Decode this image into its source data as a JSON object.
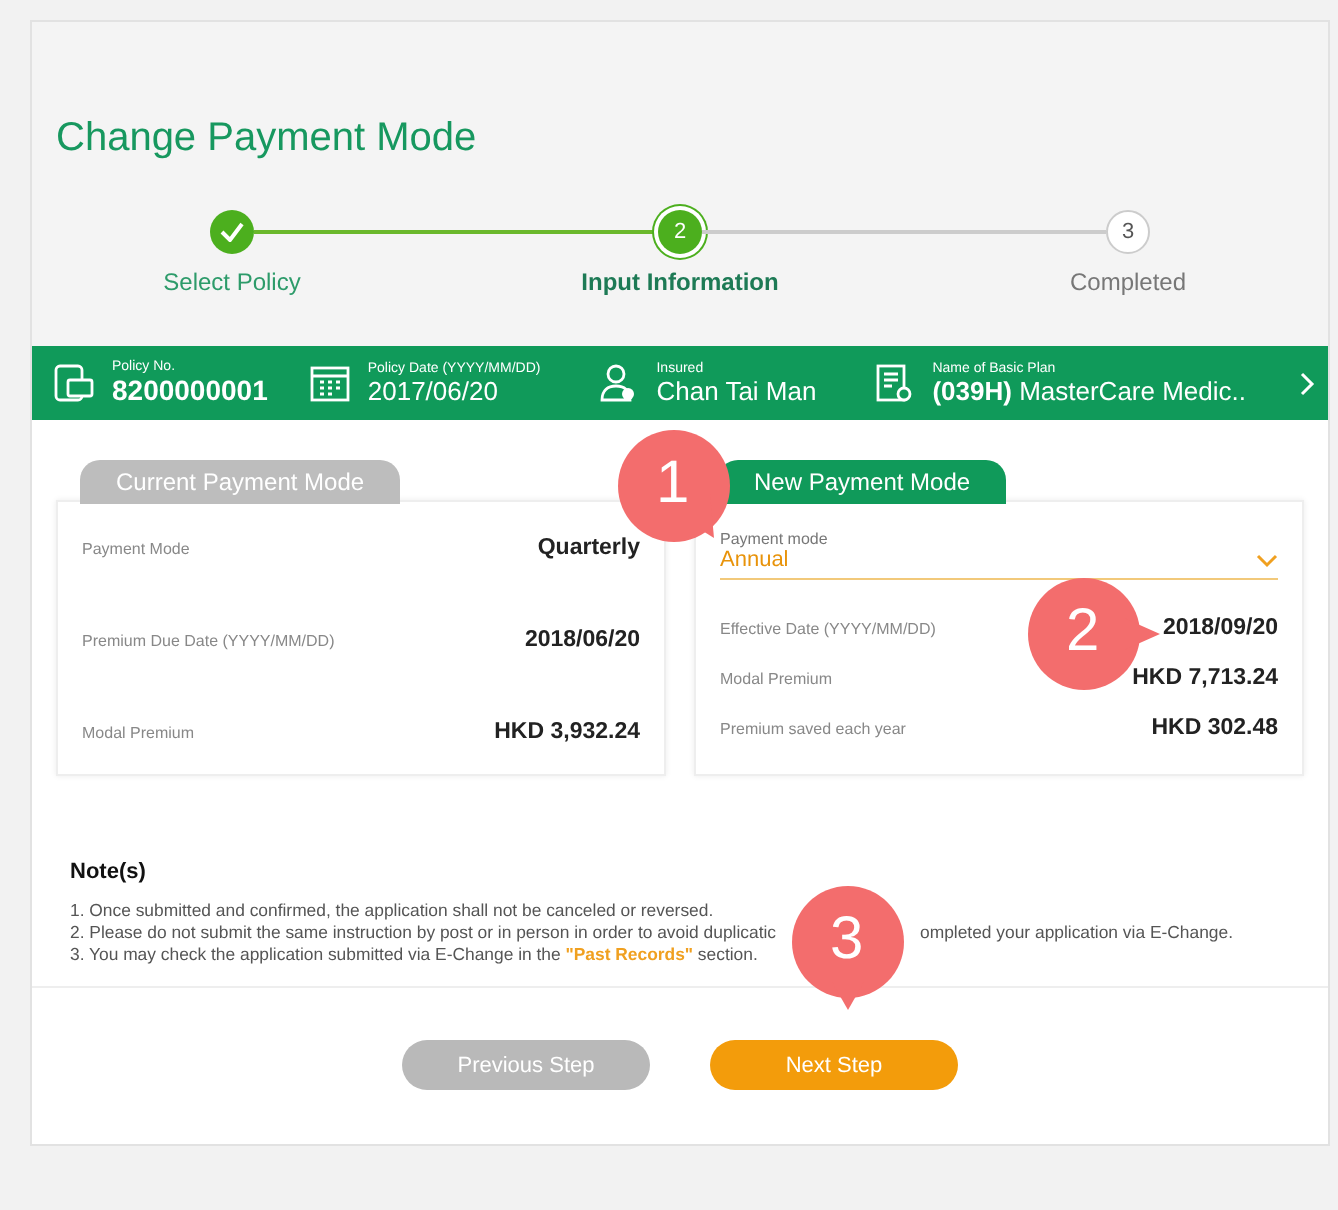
{
  "title": "Change Payment Mode",
  "steps": [
    {
      "label": "Select Policy",
      "done": true,
      "selected": false
    },
    {
      "label": "Input Information",
      "number": "2",
      "done": false,
      "selected": true
    },
    {
      "label": "Completed",
      "number": "3",
      "done": false,
      "selected": false
    }
  ],
  "policy_bar": [
    {
      "kind": "policy",
      "label": "Policy No.",
      "value": "8200000001"
    },
    {
      "kind": "calendar",
      "label": "Policy Date (YYYY/MM/DD)",
      "value": "2017/06/20"
    },
    {
      "kind": "person",
      "label": "Insured",
      "value": "Chan Tai Man"
    },
    {
      "kind": "plan",
      "label": "Name of Basic Plan",
      "value": "**(039H)** MasterCare Medic.."
    }
  ],
  "current_mode": {
    "heading": "Current Payment Mode",
    "rows": [
      {
        "label": "Payment Mode",
        "value": "Quarterly"
      },
      {
        "label": "Premium Due Date (YYYY/MM/DD)",
        "value": "2018/06/20"
      },
      {
        "label": "Modal Premium",
        "value": "HKD 3,932.24"
      }
    ]
  },
  "new_mode": {
    "heading": "New Payment Mode",
    "select": {
      "label": "Payment mode",
      "value": "Annual"
    },
    "rows": [
      {
        "label": "Effective Date (YYYY/MM/DD)",
        "value": "2018/09/20"
      },
      {
        "label": "Modal Premium",
        "value": "HKD 7,713.24"
      },
      {
        "label": "Premium saved each year",
        "value": "HKD 302.48"
      }
    ]
  },
  "notes": {
    "heading": "Note(s)",
    "lines": [
      [
        "1. Once submitted and confirmed, the application shall not be canceled or reversed."
      ],
      [
        "2. Please do not submit the same instruction by post or in person in order to avoid duplicatic",
        "ompleted your application via E-Change."
      ],
      [
        "3. You may check the application submitted via E-Change in the **\"Past Records\"** section."
      ]
    ]
  },
  "buttons": [
    {
      "label": "Previous Step",
      "disabled": true
    },
    {
      "label": "Next Step",
      "disabled": false
    }
  ],
  "callouts": [
    "1",
    "2",
    "3"
  ]
}
